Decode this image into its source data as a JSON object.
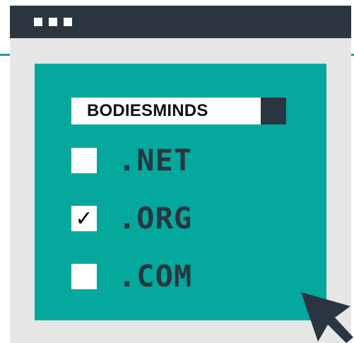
{
  "domain": {
    "name": "BODIESMINDS"
  },
  "options": [
    {
      "tld": ".NET",
      "checked": false,
      "mark": ""
    },
    {
      "tld": ".ORG",
      "checked": true,
      "mark": "✓"
    },
    {
      "tld": ".COM",
      "checked": false,
      "mark": ""
    }
  ],
  "colors": {
    "teal": "#04a89c",
    "navy": "#2b3541",
    "window": "#e6e6e6"
  },
  "icons": {
    "window_controls": [
      "window-dot-icon",
      "window-dot-icon",
      "window-dot-icon"
    ],
    "pointer": "mouse-cursor-icon"
  }
}
